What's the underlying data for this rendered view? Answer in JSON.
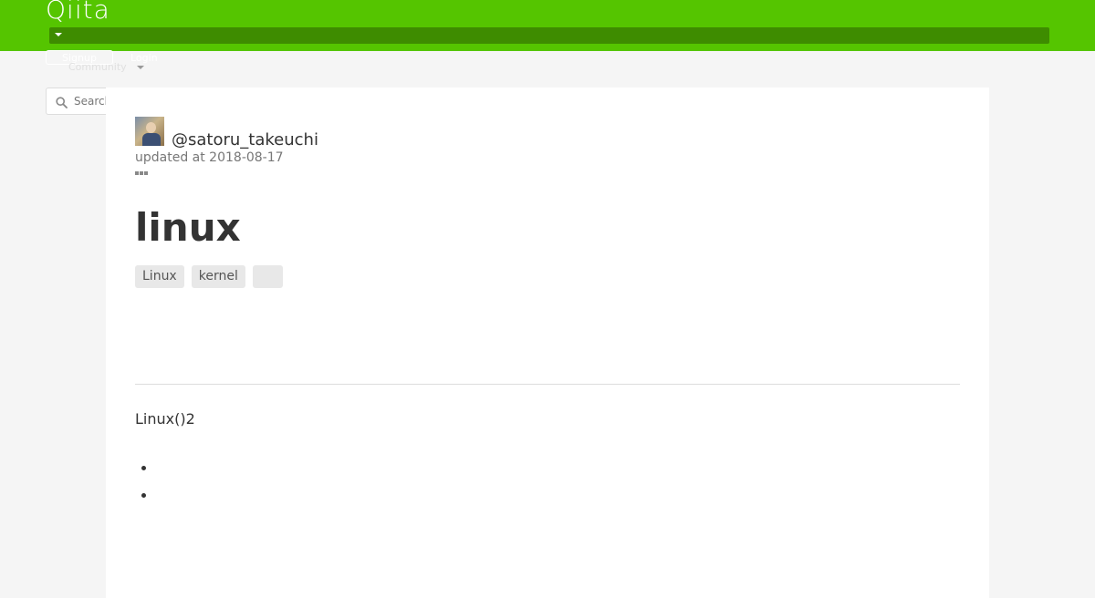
{
  "header": {
    "logo": "Qiita",
    "signup_label": "Signup",
    "login_label": "Login",
    "community_label": "Community",
    "brand_color": "#55c500",
    "bar_color": "#3e8c00"
  },
  "search": {
    "placeholder": "Search",
    "value": "",
    "icon": "search-icon"
  },
  "article": {
    "author": "@satoru_takeuchi",
    "updated": "updated at 2018-08-17",
    "title": "linux",
    "tags": [
      "Linux",
      "kernel",
      ""
    ],
    "body_text": "Linux()2",
    "list_items": [
      "",
      ""
    ]
  }
}
